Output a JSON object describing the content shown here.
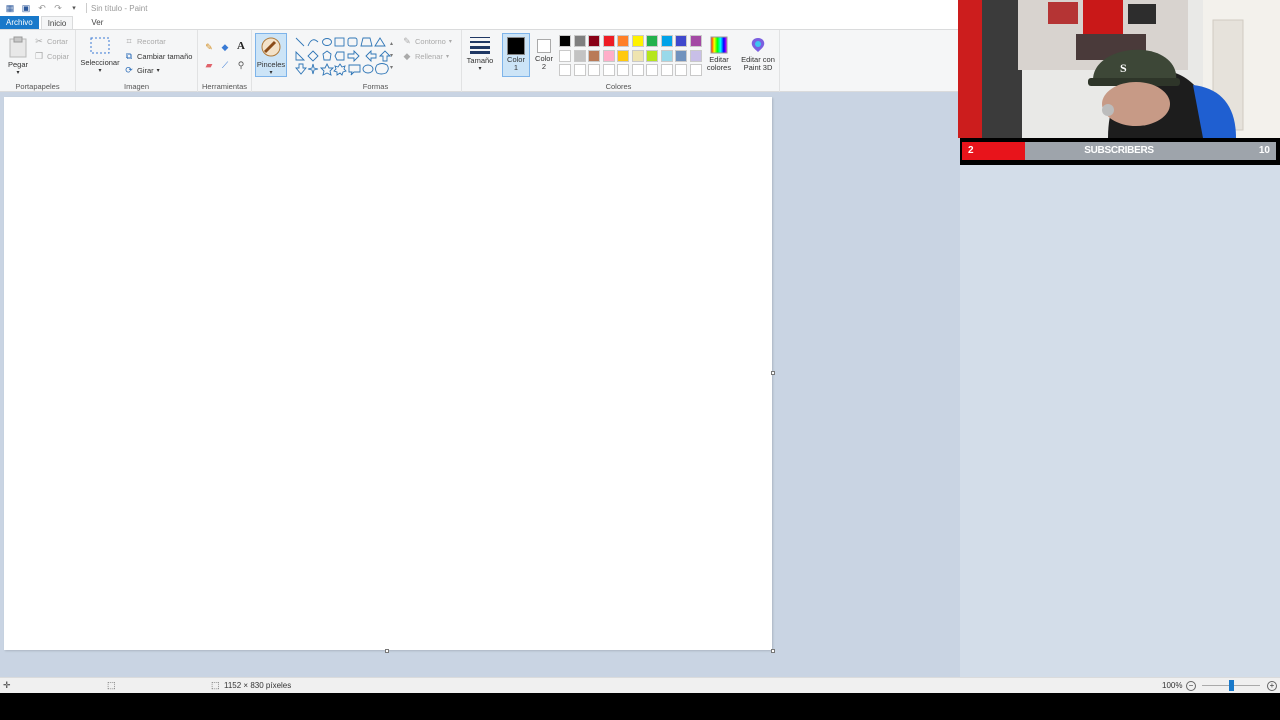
{
  "window": {
    "title": "Sin título - Paint"
  },
  "tabs": [
    {
      "label": "Archivo"
    },
    {
      "label": "Inicio"
    },
    {
      "label": "Ver"
    }
  ],
  "ribbon": {
    "clipboard": {
      "paste_label": "Pegar",
      "cut_label": "Cortar",
      "copy_label": "Copiar",
      "group_label": "Portapapeles"
    },
    "image": {
      "select_label": "Seleccionar",
      "crop_label": "Recortar",
      "resize_label": "Cambiar tamaño",
      "rotate_label": "Girar",
      "group_label": "Imagen"
    },
    "tools": {
      "group_label": "Herramientas",
      "brushes_label": "Pinceles"
    },
    "shapes": {
      "outline_label": "Contorno",
      "fill_label": "Rellenar",
      "group_label": "Formas"
    },
    "size": {
      "label": "Tamaño"
    },
    "colors": {
      "color1_label": "Color 1",
      "color2_label": "Color 2",
      "edit_colors_label": "Editar colores",
      "paint3d_label": "Editar con Paint 3D",
      "group_label": "Colores",
      "color1": "#000000",
      "color2": "#ffffff",
      "palette_row1": [
        "#000000",
        "#7f7f7f",
        "#880015",
        "#ed1c24",
        "#ff7f27",
        "#fff200",
        "#22b14c",
        "#00a2e8",
        "#3f48cc",
        "#a349a4"
      ],
      "palette_row2": [
        "#ffffff",
        "#c3c3c3",
        "#b97a57",
        "#ffaec9",
        "#ffc90e",
        "#efe4b0",
        "#b5e61d",
        "#99d9ea",
        "#7092be",
        "#c8bfe7"
      ]
    }
  },
  "statusbar": {
    "dimensions": "1152 × 830 píxeles",
    "zoom": "100%",
    "zoom_fraction": 0.5
  },
  "overlay": {
    "subscribers_label": "SUBSCRIBERS",
    "current": "2",
    "goal": "10",
    "progress": 0.2
  }
}
